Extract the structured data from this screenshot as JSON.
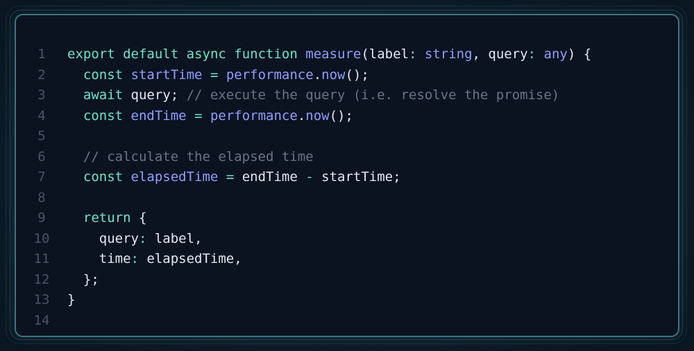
{
  "lines": [
    {
      "num": "1",
      "tokens": [
        {
          "t": "export",
          "c": "kw"
        },
        {
          "t": " ",
          "c": "pl"
        },
        {
          "t": "default",
          "c": "kw"
        },
        {
          "t": " ",
          "c": "pl"
        },
        {
          "t": "async",
          "c": "kw"
        },
        {
          "t": " ",
          "c": "pl"
        },
        {
          "t": "function",
          "c": "kw"
        },
        {
          "t": " ",
          "c": "pl"
        },
        {
          "t": "measure",
          "c": "fn"
        },
        {
          "t": "(label",
          "c": "pl"
        },
        {
          "t": ":",
          "c": "op"
        },
        {
          "t": " ",
          "c": "pl"
        },
        {
          "t": "string",
          "c": "ty"
        },
        {
          "t": ", query",
          "c": "pl"
        },
        {
          "t": ":",
          "c": "op"
        },
        {
          "t": " ",
          "c": "pl"
        },
        {
          "t": "any",
          "c": "ty"
        },
        {
          "t": ") {",
          "c": "pl"
        }
      ]
    },
    {
      "num": "2",
      "tokens": [
        {
          "t": "  ",
          "c": "pl"
        },
        {
          "t": "const",
          "c": "kw"
        },
        {
          "t": " ",
          "c": "pl"
        },
        {
          "t": "startTime",
          "c": "fn"
        },
        {
          "t": " ",
          "c": "pl"
        },
        {
          "t": "=",
          "c": "op"
        },
        {
          "t": " ",
          "c": "pl"
        },
        {
          "t": "performance",
          "c": "fn"
        },
        {
          "t": ".",
          "c": "pl"
        },
        {
          "t": "now",
          "c": "fn"
        },
        {
          "t": "();",
          "c": "pl"
        }
      ]
    },
    {
      "num": "3",
      "tokens": [
        {
          "t": "  ",
          "c": "pl"
        },
        {
          "t": "await",
          "c": "kw"
        },
        {
          "t": " query; ",
          "c": "pl"
        },
        {
          "t": "// execute the query (i.e. resolve the promise)",
          "c": "cm"
        }
      ]
    },
    {
      "num": "4",
      "tokens": [
        {
          "t": "  ",
          "c": "pl"
        },
        {
          "t": "const",
          "c": "kw"
        },
        {
          "t": " ",
          "c": "pl"
        },
        {
          "t": "endTime",
          "c": "fn"
        },
        {
          "t": " ",
          "c": "pl"
        },
        {
          "t": "=",
          "c": "op"
        },
        {
          "t": " ",
          "c": "pl"
        },
        {
          "t": "performance",
          "c": "fn"
        },
        {
          "t": ".",
          "c": "pl"
        },
        {
          "t": "now",
          "c": "fn"
        },
        {
          "t": "();",
          "c": "pl"
        }
      ]
    },
    {
      "num": "5",
      "tokens": []
    },
    {
      "num": "6",
      "tokens": [
        {
          "t": "  ",
          "c": "pl"
        },
        {
          "t": "// calculate the elapsed time",
          "c": "cm"
        }
      ]
    },
    {
      "num": "7",
      "tokens": [
        {
          "t": "  ",
          "c": "pl"
        },
        {
          "t": "const",
          "c": "kw"
        },
        {
          "t": " ",
          "c": "pl"
        },
        {
          "t": "elapsedTime",
          "c": "fn"
        },
        {
          "t": " ",
          "c": "pl"
        },
        {
          "t": "=",
          "c": "op"
        },
        {
          "t": " endTime ",
          "c": "pl"
        },
        {
          "t": "-",
          "c": "op"
        },
        {
          "t": " startTime;",
          "c": "pl"
        }
      ]
    },
    {
      "num": "8",
      "tokens": []
    },
    {
      "num": "9",
      "tokens": [
        {
          "t": "  ",
          "c": "pl"
        },
        {
          "t": "return",
          "c": "kw"
        },
        {
          "t": " {",
          "c": "pl"
        }
      ]
    },
    {
      "num": "10",
      "tokens": [
        {
          "t": "    query",
          "c": "pl"
        },
        {
          "t": ":",
          "c": "op"
        },
        {
          "t": " label,",
          "c": "pl"
        }
      ]
    },
    {
      "num": "11",
      "tokens": [
        {
          "t": "    time",
          "c": "pl"
        },
        {
          "t": ":",
          "c": "op"
        },
        {
          "t": " elapsedTime,",
          "c": "pl"
        }
      ]
    },
    {
      "num": "12",
      "tokens": [
        {
          "t": "  };",
          "c": "pl"
        }
      ]
    },
    {
      "num": "13",
      "tokens": [
        {
          "t": "}",
          "c": "pl"
        }
      ]
    },
    {
      "num": "14",
      "tokens": []
    }
  ],
  "colors": {
    "keyword": "#6ee7c6",
    "function": "#8fa0ff",
    "comment": "#6b7487",
    "text": "#e6e9f0",
    "line_number": "#4a5568",
    "background": "#0b1220",
    "border": "#3f7480"
  }
}
